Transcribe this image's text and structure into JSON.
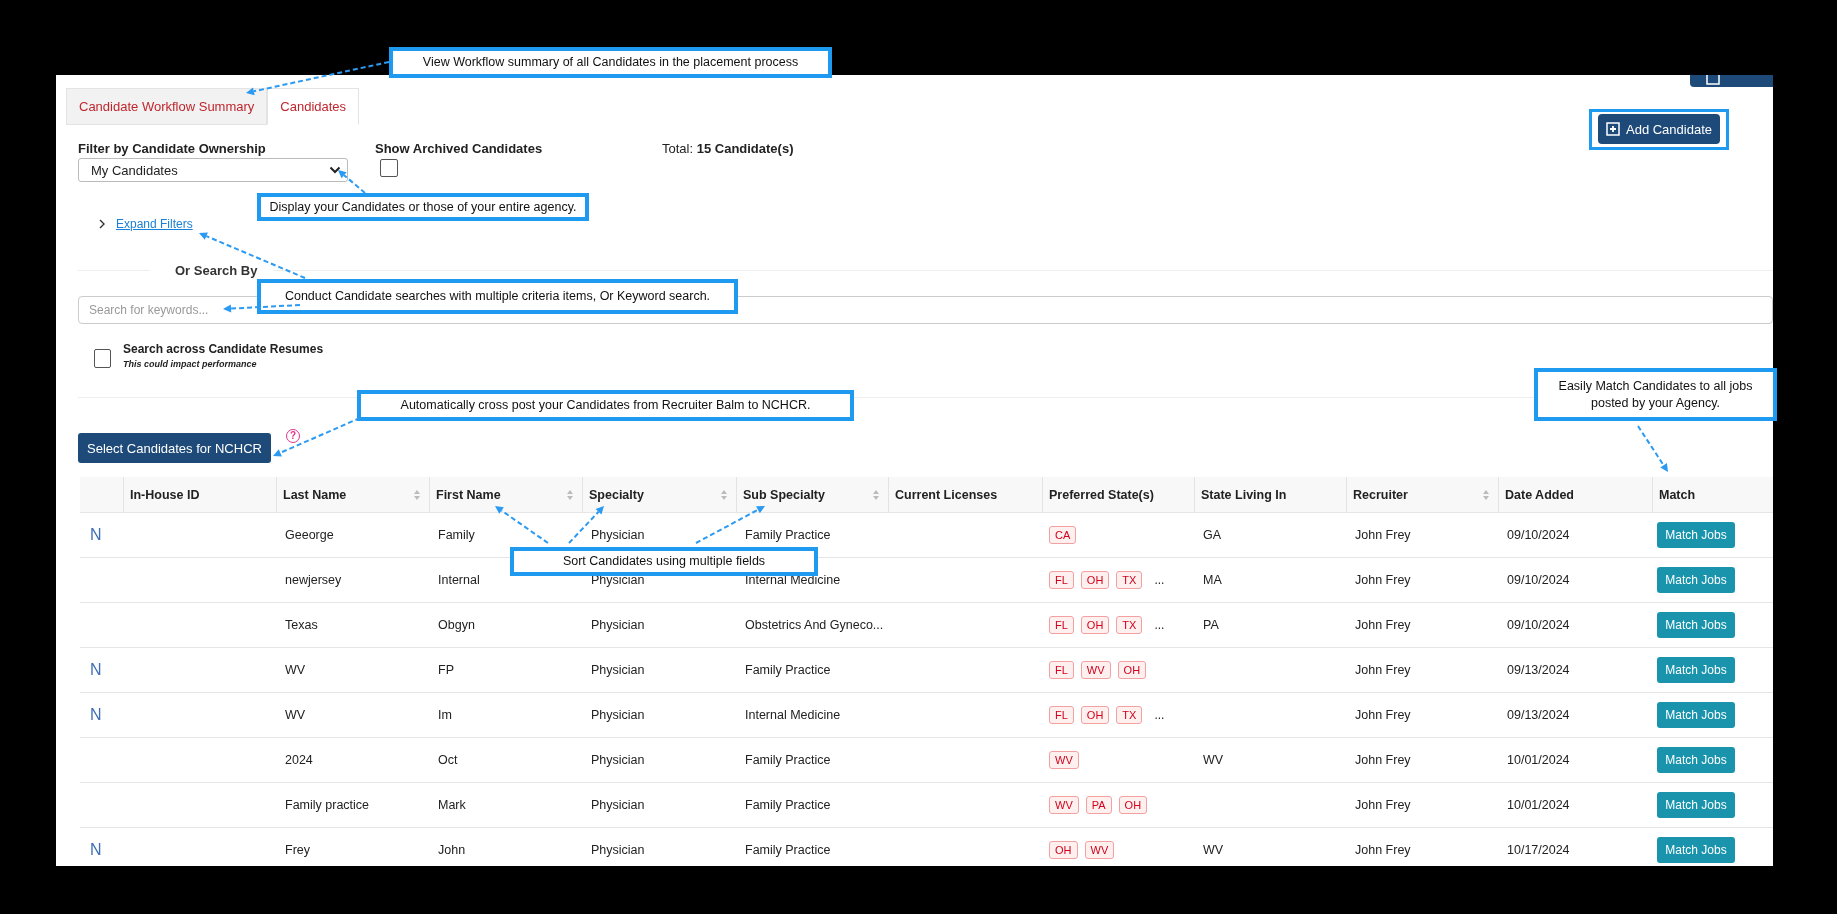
{
  "annotations": [
    {
      "text": "View Workflow summary of all Candidates in the placement process"
    },
    {
      "text": "Display your Candidates or those of your entire agency."
    },
    {
      "text": "Conduct Candidate searches with multiple criteria items, Or Keyword search."
    },
    {
      "text": "Automatically cross post your Candidates from Recruiter Balm to NCHCR."
    },
    {
      "text": "Easily Match Candidates to all jobs posted by your Agency."
    },
    {
      "text": "Sort Candidates using multiple fields"
    }
  ],
  "tabs": [
    {
      "label": "Candidate Workflow Summary",
      "selected": false
    },
    {
      "label": "Candidates",
      "selected": true
    }
  ],
  "filter": {
    "label": "Filter by Candidate Ownership",
    "value": "My Candidates"
  },
  "archived": {
    "label": "Show Archived Candidates",
    "checked": false
  },
  "total": {
    "label": "Total:",
    "value": "15 Candidate(s)"
  },
  "add_button": {
    "label": "Add Candidate"
  },
  "expand_filters": {
    "label": "Expand Filters",
    "expanded": false
  },
  "search": {
    "heading": "Or Search By",
    "placeholder": "Search for keywords..."
  },
  "resume_search": {
    "label": "Search across Candidate Resumes",
    "note": "This could impact performance",
    "checked": false
  },
  "nchcr_button": {
    "label": "Select Candidates for NCHCR",
    "help": "?"
  },
  "table": {
    "columns": [
      {
        "label": "In-House ID",
        "sortable": false
      },
      {
        "label": "Last Name",
        "sortable": true
      },
      {
        "label": "First Name",
        "sortable": true
      },
      {
        "label": "Specialty",
        "sortable": true
      },
      {
        "label": "Sub Specialty",
        "sortable": true
      },
      {
        "label": "Current Licenses",
        "sortable": false
      },
      {
        "label": "Preferred State(s)",
        "sortable": false
      },
      {
        "label": "State Living In",
        "sortable": false
      },
      {
        "label": "Recruiter",
        "sortable": true
      },
      {
        "label": "Date Added",
        "sortable": false
      },
      {
        "label": "Match",
        "sortable": false
      }
    ],
    "rows": [
      {
        "flag": "N",
        "last_name": "Geeorge",
        "first_name": "Family",
        "specialty": "Physician",
        "sub_specialty": "Family Practice",
        "preferred_states": [
          "CA"
        ],
        "state_living": "GA",
        "recruiter": "John Frey",
        "date_added": "09/10/2024",
        "action": "Match Jobs"
      },
      {
        "last_name": "newjersey",
        "first_name": "Internal",
        "specialty": "Physician",
        "sub_specialty": "Internal Medicine",
        "preferred_states": [
          "FL",
          "OH",
          "TX"
        ],
        "more": "...",
        "state_living": "MA",
        "recruiter": "John Frey",
        "date_added": "09/10/2024",
        "action": "Match Jobs"
      },
      {
        "last_name": "Texas",
        "first_name": "Obgyn",
        "specialty": "Physician",
        "sub_specialty": "Obstetrics And Gyneco...",
        "preferred_states": [
          "FL",
          "OH",
          "TX"
        ],
        "more": "...",
        "state_living": "PA",
        "recruiter": "John Frey",
        "date_added": "09/10/2024",
        "action": "Match Jobs"
      },
      {
        "flag": "N",
        "last_name": "WV",
        "first_name": "FP",
        "specialty": "Physician",
        "sub_specialty": "Family Practice",
        "preferred_states": [
          "FL",
          "WV",
          "OH"
        ],
        "recruiter": "John Frey",
        "date_added": "09/13/2024",
        "action": "Match Jobs"
      },
      {
        "flag": "N",
        "last_name": "WV",
        "first_name": "Im",
        "specialty": "Physician",
        "sub_specialty": "Internal Medicine",
        "preferred_states": [
          "FL",
          "OH",
          "TX"
        ],
        "more": "...",
        "recruiter": "John Frey",
        "date_added": "09/13/2024",
        "action": "Match Jobs"
      },
      {
        "last_name": "2024",
        "first_name": "Oct",
        "specialty": "Physician",
        "sub_specialty": "Family Practice",
        "preferred_states": [
          "WV"
        ],
        "state_living": "WV",
        "recruiter": "John Frey",
        "date_added": "10/01/2024",
        "action": "Match Jobs"
      },
      {
        "last_name": "Family practice",
        "first_name": "Mark",
        "specialty": "Physician",
        "sub_specialty": "Family Practice",
        "preferred_states": [
          "WV",
          "PA",
          "OH"
        ],
        "recruiter": "John Frey",
        "date_added": "10/01/2024",
        "action": "Match Jobs"
      },
      {
        "flag": "N",
        "last_name": "Frey",
        "first_name": "John",
        "specialty": "Physician",
        "sub_specialty": "Family Practice",
        "preferred_states": [
          "OH",
          "WV"
        ],
        "state_living": "WV",
        "recruiter": "John Frey",
        "date_added": "10/17/2024",
        "action": "Match Jobs"
      }
    ]
  }
}
